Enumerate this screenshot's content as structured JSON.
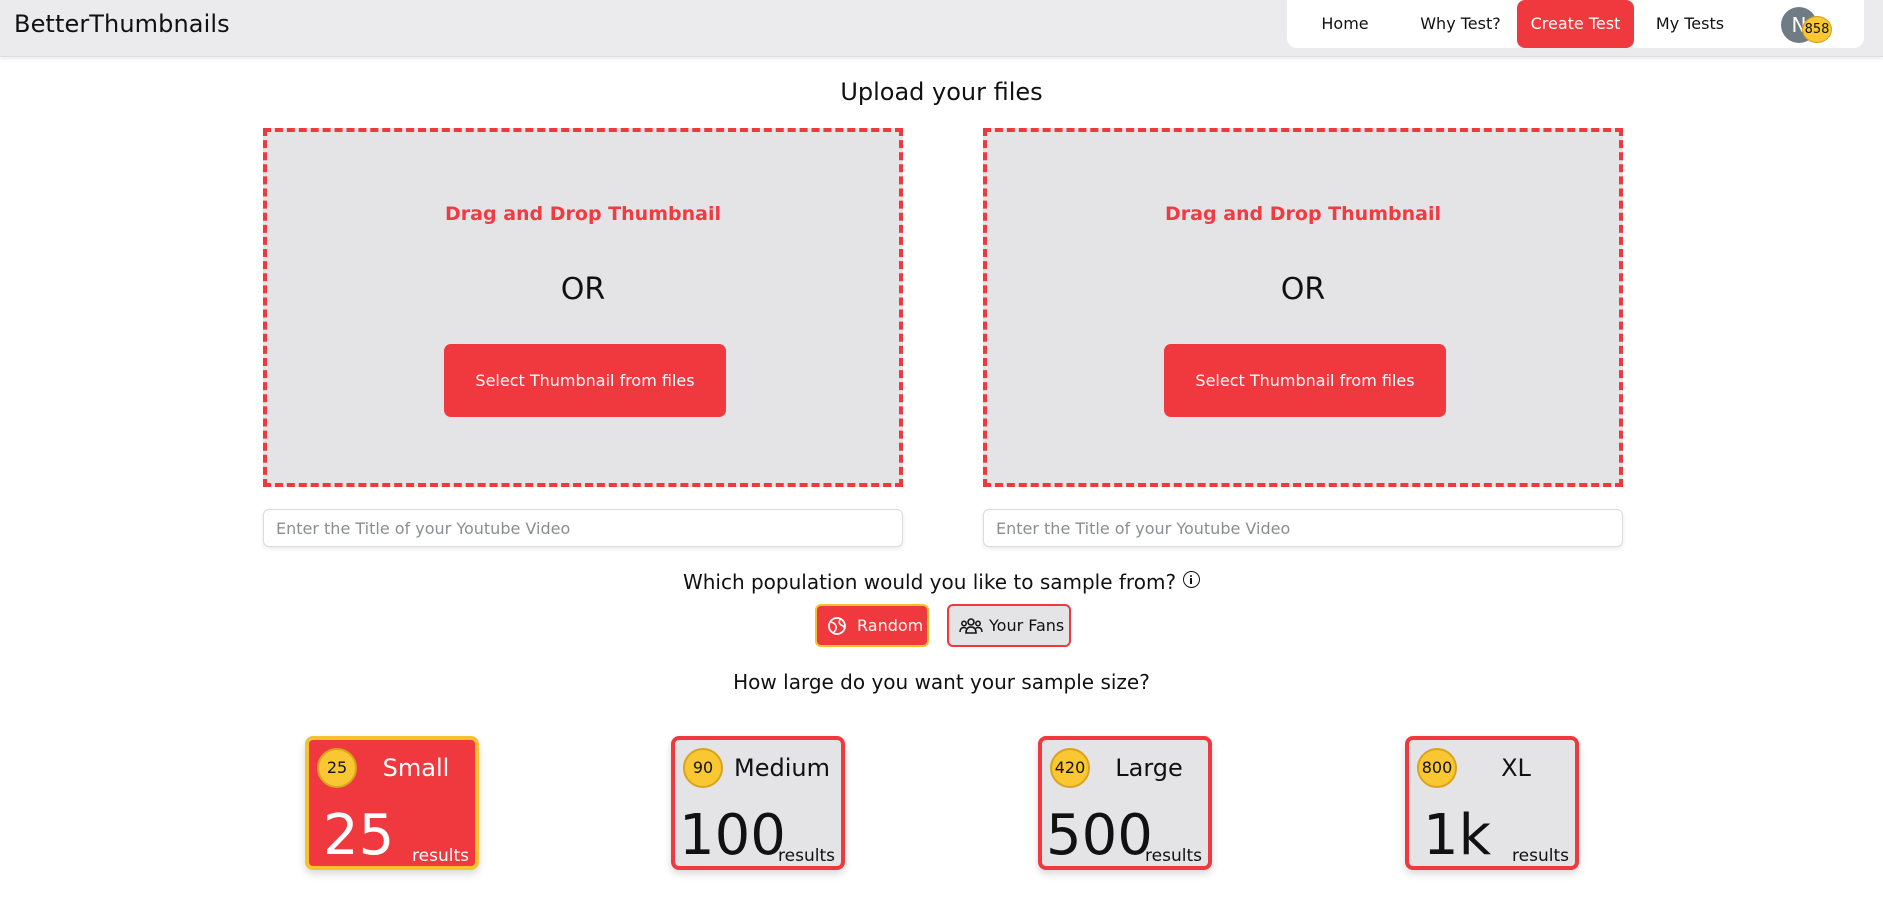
{
  "nav": {
    "brand": "BetterThumbnails",
    "links": [
      {
        "label": "Home"
      },
      {
        "label": "Why Test?"
      },
      {
        "label": "Create Test",
        "active": true
      },
      {
        "label": "My Tests"
      }
    ],
    "avatar_initial": "N",
    "credits": "858"
  },
  "upload": {
    "title": "Upload your files",
    "zones": [
      {
        "drag_label": "Drag and Drop Thumbnail",
        "or_label": "OR",
        "button_label": "Select Thumbnail from files",
        "title_placeholder": "Enter the Title of your Youtube Video",
        "title_value": ""
      },
      {
        "drag_label": "Drag and Drop Thumbnail",
        "or_label": "OR",
        "button_label": "Select Thumbnail from files",
        "title_placeholder": "Enter the Title of your Youtube Video",
        "title_value": ""
      }
    ]
  },
  "population": {
    "question": "Which population would you like to sample from?",
    "options": [
      {
        "label": "Random",
        "icon": "globe-icon",
        "selected": true
      },
      {
        "label": "Your Fans",
        "icon": "people-icon",
        "selected": false
      }
    ]
  },
  "sample": {
    "question": "How large do you want your sample size?",
    "options": [
      {
        "cost": "25",
        "name": "Small",
        "count": "25",
        "unit": "results",
        "selected": true
      },
      {
        "cost": "90",
        "name": "Medium",
        "count": "100",
        "unit": "results",
        "selected": false
      },
      {
        "cost": "420",
        "name": "Large",
        "count": "500",
        "unit": "results",
        "selected": false
      },
      {
        "cost": "800",
        "name": "XL",
        "count": "1k",
        "unit": "results",
        "selected": false
      }
    ]
  },
  "colors": {
    "accent": "#f0393f",
    "highlight": "#f8c22e",
    "panel": "#e4e4e7",
    "navbar": "#ebebee"
  }
}
